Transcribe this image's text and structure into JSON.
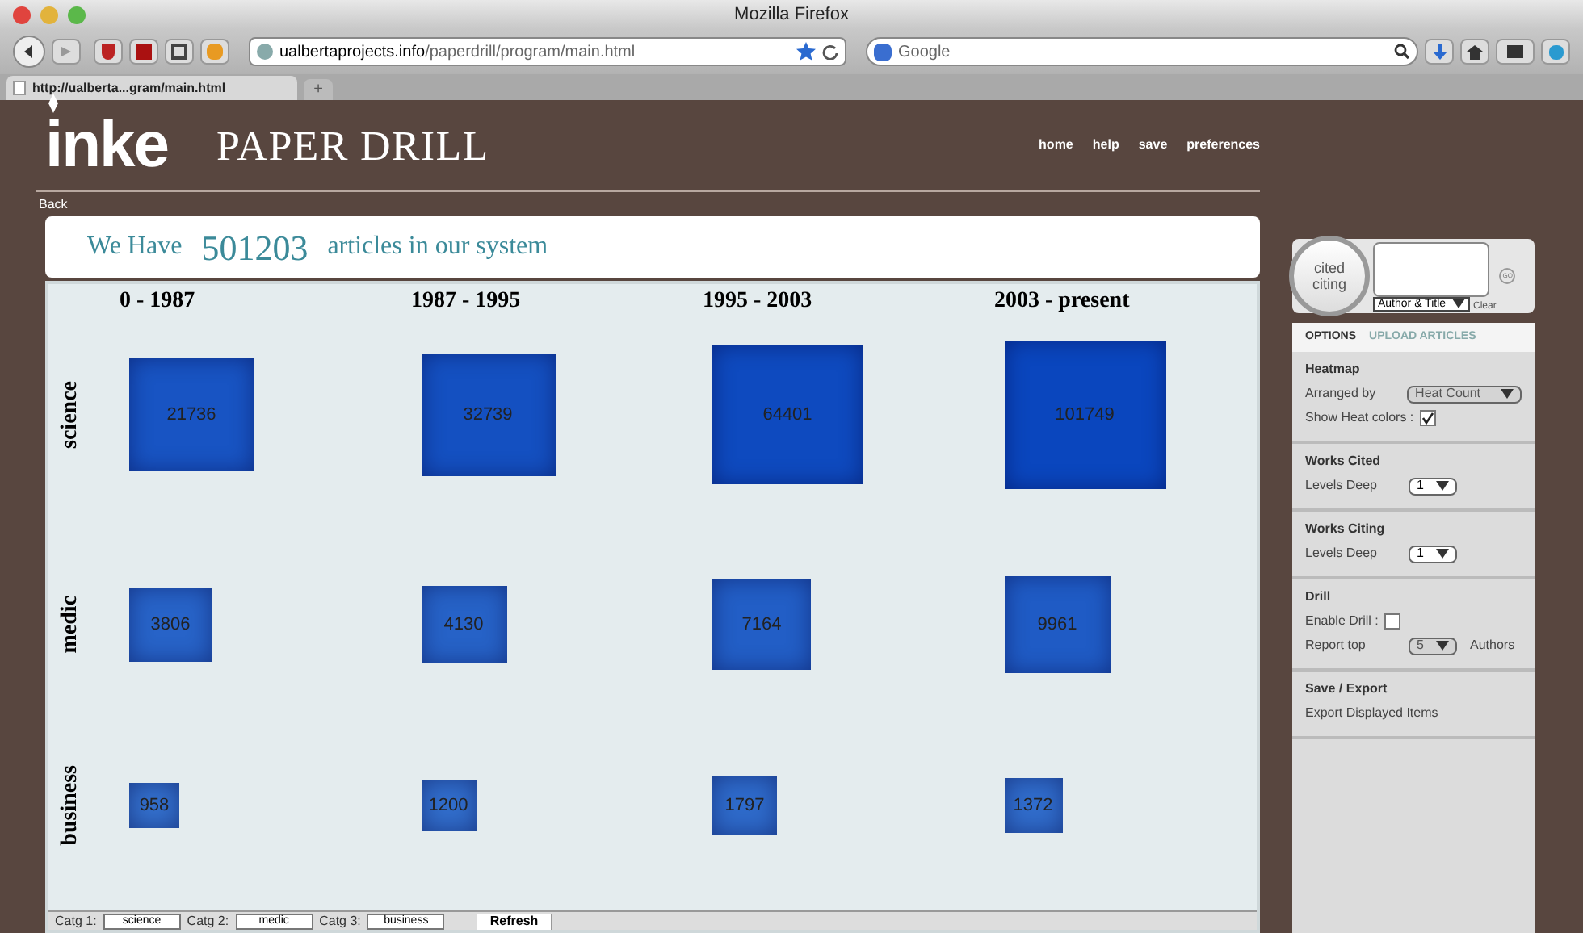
{
  "window": {
    "title": "Mozilla Firefox"
  },
  "toolbar": {
    "url_host": "ualbertaprojects.info",
    "url_path": "/paperdrill/program/main.html",
    "search_placeholder": "Google"
  },
  "tabs": [
    {
      "label": "http://ualberta...gram/main.html",
      "selected": true
    }
  ],
  "new_tab": "+",
  "header": {
    "logo": "inke",
    "title": "PAPER DRILL",
    "nav": [
      "home",
      "help",
      "save",
      "preferences"
    ],
    "back": "Back"
  },
  "summary": {
    "before": "We Have",
    "count": "501203",
    "after": "articles in our system"
  },
  "heatmap": {
    "periods": [
      "0 - 1987",
      "1987 - 1995",
      "1995 - 2003",
      "2003 - present"
    ],
    "rows": [
      {
        "label": "science",
        "cells": [
          {
            "value": "21736"
          },
          {
            "value": "32739"
          },
          {
            "value": "64401"
          },
          {
            "value": "101749"
          }
        ]
      },
      {
        "label": "medic",
        "cells": [
          {
            "value": "3806"
          },
          {
            "value": "4130"
          },
          {
            "value": "7164"
          },
          {
            "value": "9961"
          }
        ]
      },
      {
        "label": "business",
        "cells": [
          {
            "value": "958"
          },
          {
            "value": "1200"
          },
          {
            "value": "1797"
          },
          {
            "value": "1372"
          }
        ]
      }
    ]
  },
  "bottom": {
    "fields": [
      {
        "label": "Catg 1:",
        "value": "science"
      },
      {
        "label": "Catg 2:",
        "value": "medic"
      },
      {
        "label": "Catg 3:",
        "value": "business"
      }
    ],
    "refresh": "Refresh"
  },
  "search_panel": {
    "toggle_top": "cited",
    "toggle_bottom": "citing",
    "mode": "Author & Title",
    "clear": "Clear",
    "go": "GO"
  },
  "options": {
    "tabs": [
      {
        "label": "OPTIONS",
        "selected": true
      },
      {
        "label": "UPLOAD ARTICLES",
        "selected": false
      }
    ],
    "sections": [
      {
        "title": "Heatmap",
        "rows": [
          {
            "kind": "select",
            "label": "Arranged by",
            "value": "Heat Count",
            "disabled": true
          },
          {
            "kind": "checkbox",
            "label": "Show Heat colors :",
            "checked": true
          }
        ]
      },
      {
        "title": "Works Cited",
        "rows": [
          {
            "kind": "select",
            "label": "Levels Deep",
            "value": "1",
            "disabled": false
          }
        ]
      },
      {
        "title": "Works Citing",
        "rows": [
          {
            "kind": "select",
            "label": "Levels Deep",
            "value": "1",
            "disabled": false
          }
        ]
      },
      {
        "title": "Drill",
        "rows": [
          {
            "kind": "checkbox",
            "label": "Enable Drill :",
            "checked": false
          },
          {
            "kind": "select",
            "label": "Report top",
            "value": "5",
            "disabled": true,
            "suffix": "Authors"
          }
        ]
      },
      {
        "title": "Save / Export",
        "rows": [
          {
            "kind": "text",
            "label": "Export Displayed Items"
          }
        ]
      }
    ]
  }
}
